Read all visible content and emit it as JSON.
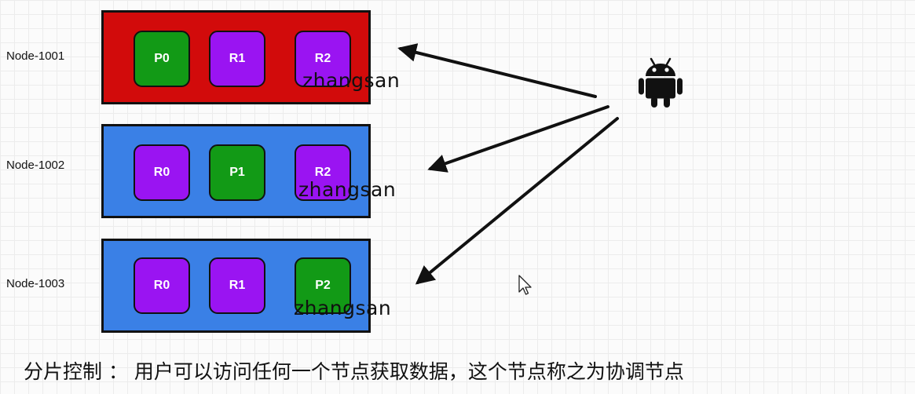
{
  "nodes": [
    {
      "label": "Node-1001",
      "color": "#d20b0b",
      "partitions": [
        {
          "label": "P0",
          "color": "#129a16"
        },
        {
          "label": "R1",
          "color": "#9a14f2"
        },
        {
          "label": "R2",
          "color": "#9a14f2"
        }
      ],
      "annotation": "zhangsan"
    },
    {
      "label": "Node-1002",
      "color": "#3a80e6",
      "partitions": [
        {
          "label": "R0",
          "color": "#9a14f2"
        },
        {
          "label": "P1",
          "color": "#129a16"
        },
        {
          "label": "R2",
          "color": "#9a14f2"
        }
      ],
      "annotation": "zhangsan"
    },
    {
      "label": "Node-1003",
      "color": "#3a80e6",
      "partitions": [
        {
          "label": "R0",
          "color": "#9a14f2"
        },
        {
          "label": "R1",
          "color": "#9a14f2"
        },
        {
          "label": "P2",
          "color": "#129a16"
        }
      ],
      "annotation": "zhangsan"
    }
  ],
  "client_icon": "android-icon",
  "pointer_icon": "mouse-pointer-icon",
  "caption": "分片控制 ： 用户可以访问任何一个节点获取数据，这个节点称之为协调节点"
}
